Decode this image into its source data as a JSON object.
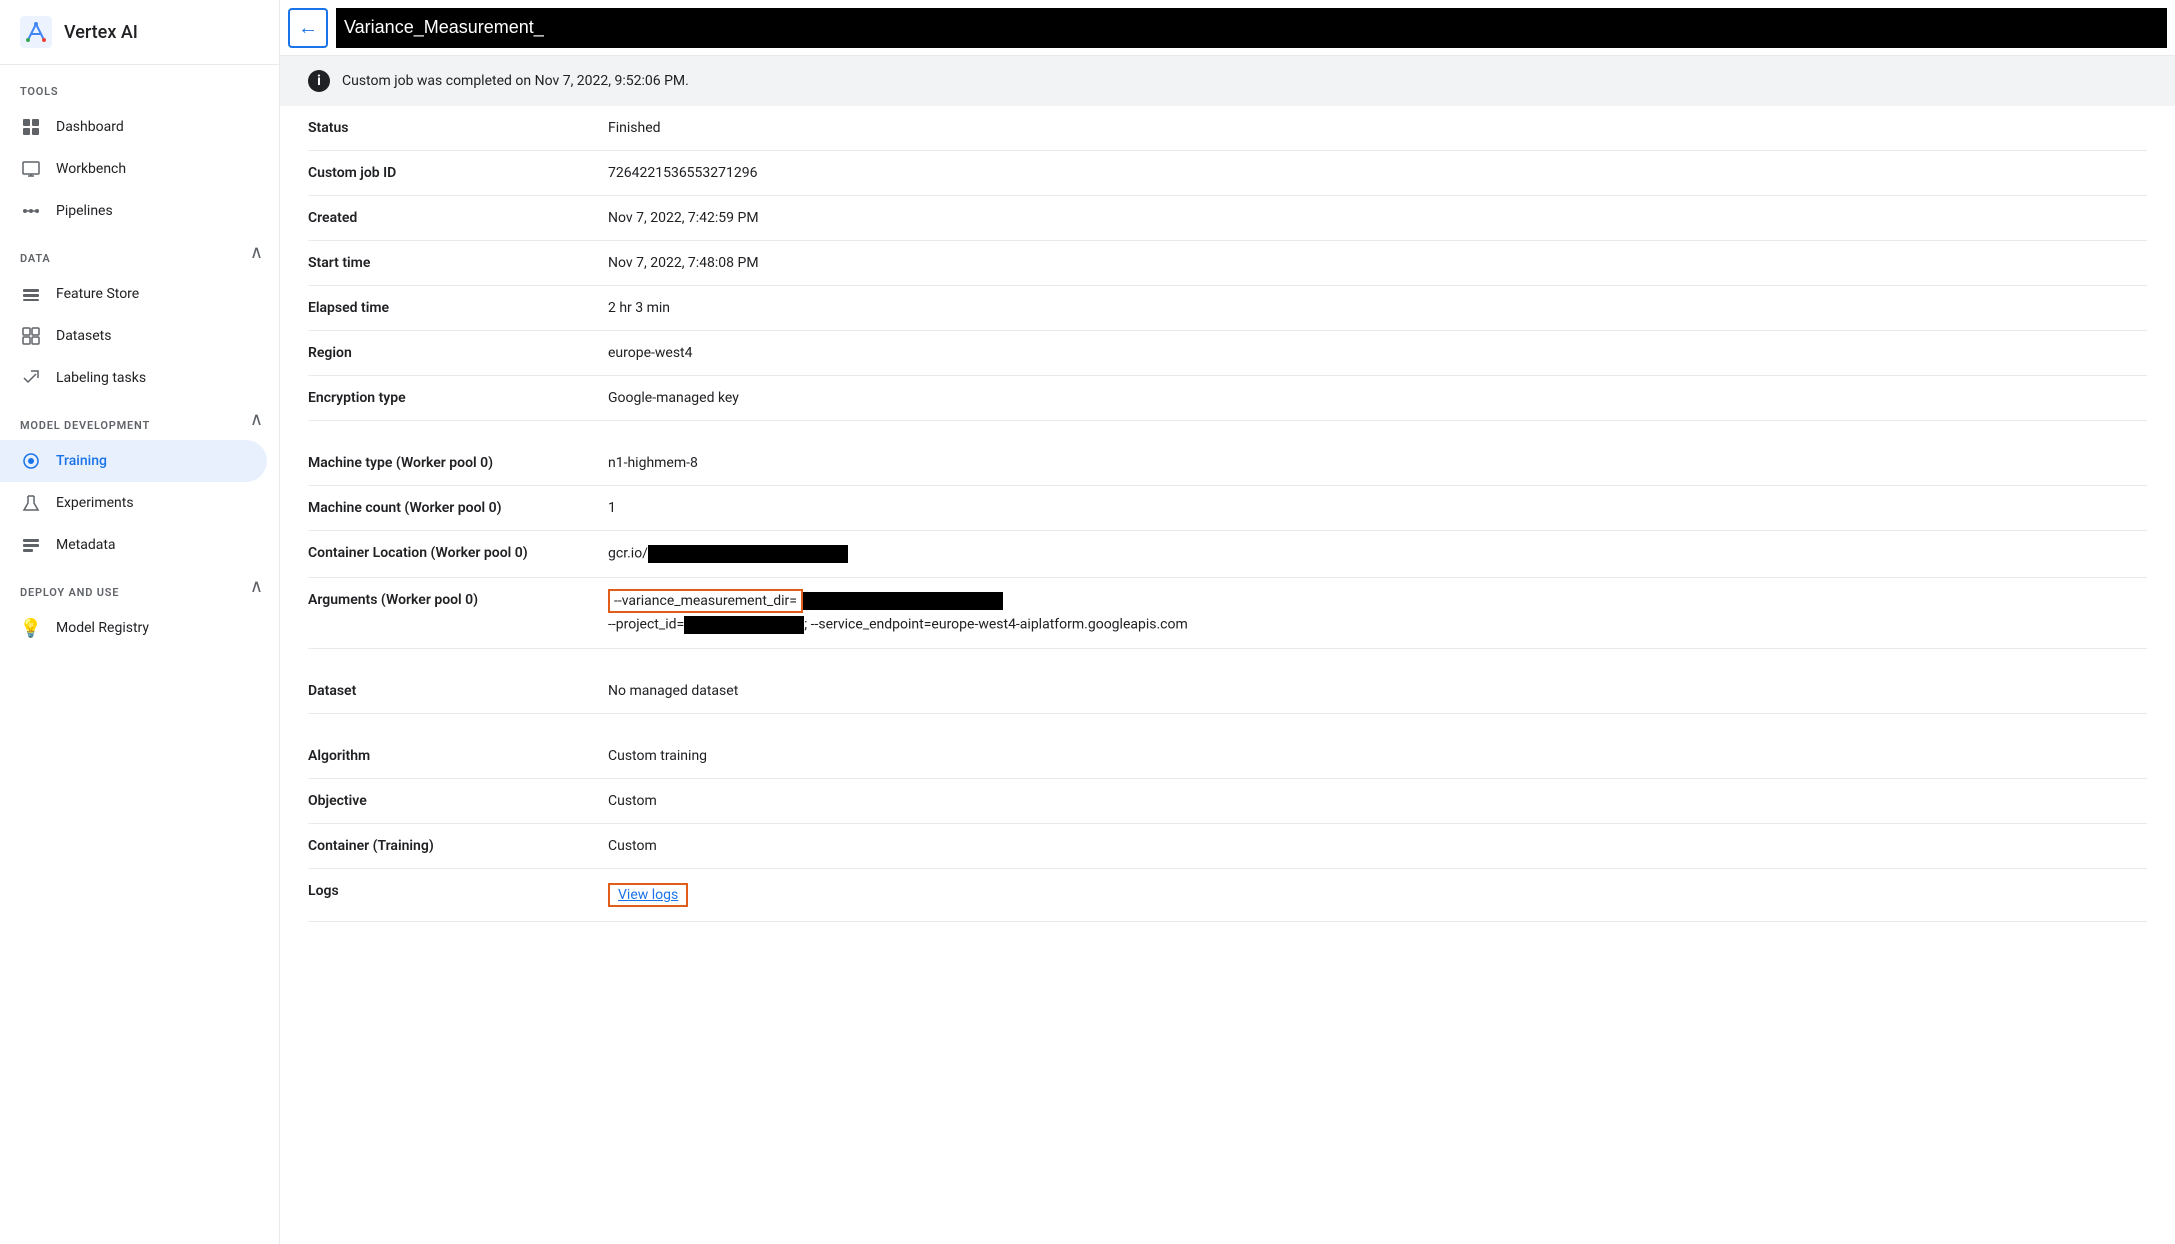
{
  "sidebar": {
    "app_name": "Vertex AI",
    "sections": [
      {
        "label": "TOOLS",
        "collapsible": false,
        "items": [
          {
            "id": "dashboard",
            "label": "Dashboard",
            "icon": "▦"
          },
          {
            "id": "workbench",
            "label": "Workbench",
            "icon": "⊡"
          },
          {
            "id": "pipelines",
            "label": "Pipelines",
            "icon": "⌥"
          }
        ]
      },
      {
        "label": "DATA",
        "collapsible": true,
        "items": [
          {
            "id": "feature-store",
            "label": "Feature Store",
            "icon": "◫"
          },
          {
            "id": "datasets",
            "label": "Datasets",
            "icon": "⊞"
          },
          {
            "id": "labeling-tasks",
            "label": "Labeling tasks",
            "icon": "🏷"
          }
        ]
      },
      {
        "label": "MODEL DEVELOPMENT",
        "collapsible": true,
        "items": [
          {
            "id": "training",
            "label": "Training",
            "icon": "⊙",
            "active": true
          },
          {
            "id": "experiments",
            "label": "Experiments",
            "icon": "▲"
          },
          {
            "id": "metadata",
            "label": "Metadata",
            "icon": "⊟"
          }
        ]
      },
      {
        "label": "DEPLOY AND USE",
        "collapsible": true,
        "items": [
          {
            "id": "model-registry",
            "label": "Model Registry",
            "icon": "💡"
          }
        ]
      }
    ]
  },
  "topbar": {
    "back_label": "←",
    "title": "Variance_Measurement_"
  },
  "info_banner": {
    "message": "Custom job was completed on Nov 7, 2022, 9:52:06 PM."
  },
  "details": {
    "sections": [
      {
        "rows": [
          {
            "label": "Status",
            "value": "Finished",
            "type": "text"
          },
          {
            "label": "Custom job ID",
            "value": "7264221536553271296",
            "type": "text"
          },
          {
            "label": "Created",
            "value": "Nov 7, 2022, 7:42:59 PM",
            "type": "text"
          },
          {
            "label": "Start time",
            "value": "Nov 7, 2022, 7:48:08 PM",
            "type": "text"
          },
          {
            "label": "Elapsed time",
            "value": "2 hr 3 min",
            "type": "text"
          },
          {
            "label": "Region",
            "value": "europe-west4",
            "type": "text"
          },
          {
            "label": "Encryption type",
            "value": "Google-managed key",
            "type": "text"
          }
        ]
      },
      {
        "rows": [
          {
            "label": "Machine type (Worker pool 0)",
            "value": "n1-highmem-8",
            "type": "text"
          },
          {
            "label": "Machine count (Worker pool 0)",
            "value": "1",
            "type": "text"
          },
          {
            "label": "Container Location (Worker pool 0)",
            "value": "gcr.io/",
            "type": "redacted"
          },
          {
            "label": "Arguments (Worker pool 0)",
            "value": "--variance_measurement_dir=",
            "value2": "--project_id=",
            "value3": "; --service_endpoint=europe-west4-aiplatform.googleapis.com",
            "type": "arguments"
          }
        ]
      },
      {
        "rows": [
          {
            "label": "Dataset",
            "value": "No managed dataset",
            "type": "text"
          }
        ]
      },
      {
        "rows": [
          {
            "label": "Algorithm",
            "value": "Custom training",
            "type": "text"
          },
          {
            "label": "Objective",
            "value": "Custom",
            "type": "text"
          },
          {
            "label": "Container (Training)",
            "value": "Custom",
            "type": "text"
          },
          {
            "label": "Logs",
            "value": "View logs",
            "type": "link"
          }
        ]
      }
    ]
  }
}
